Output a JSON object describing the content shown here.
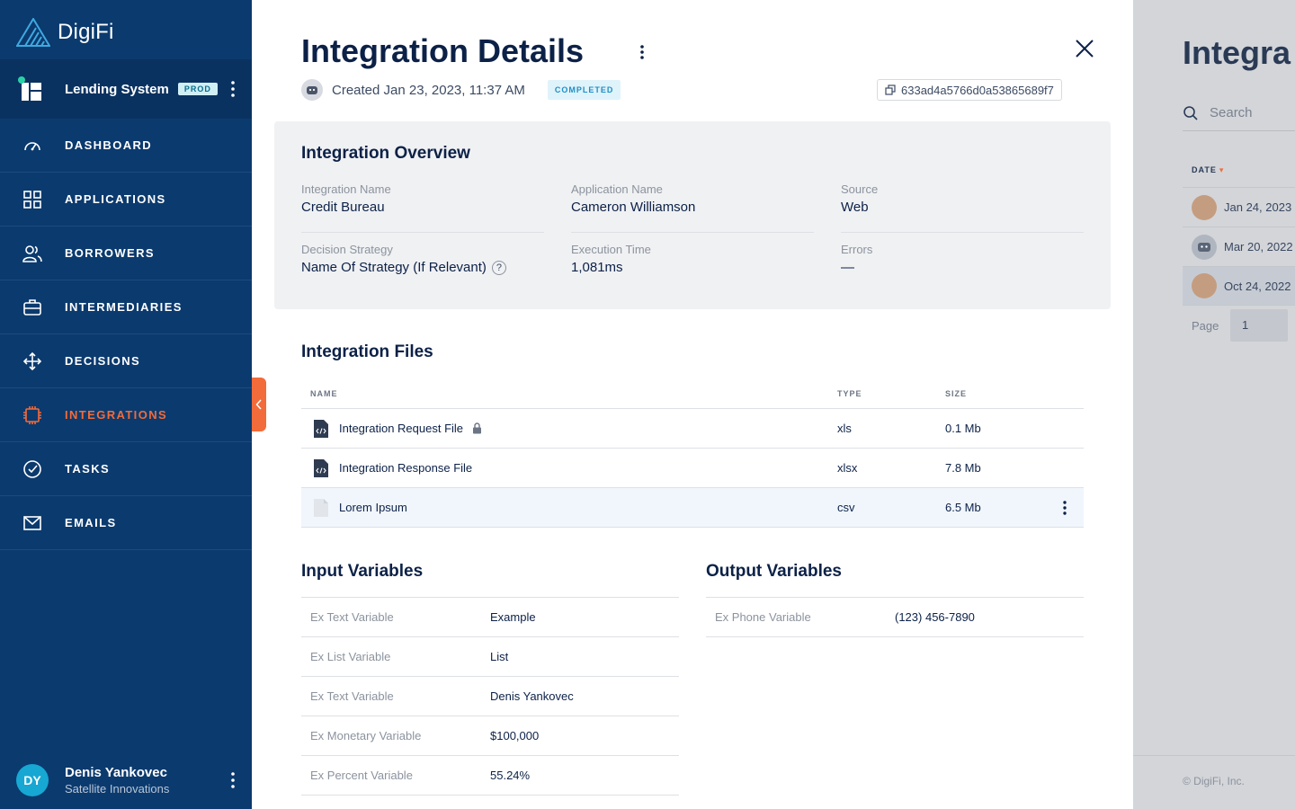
{
  "app": {
    "brand": "DigiFi"
  },
  "system": {
    "name": "Lending System",
    "env_badge": "PROD"
  },
  "nav": [
    {
      "label": "DASHBOARD",
      "icon": "dashboard-icon"
    },
    {
      "label": "APPLICATIONS",
      "icon": "applications-icon"
    },
    {
      "label": "BORROWERS",
      "icon": "borrowers-icon"
    },
    {
      "label": "INTERMEDIARIES",
      "icon": "intermediaries-icon"
    },
    {
      "label": "DECISIONS",
      "icon": "decisions-icon"
    },
    {
      "label": "INTEGRATIONS",
      "icon": "integrations-icon",
      "active": true
    },
    {
      "label": "TASKS",
      "icon": "tasks-icon"
    },
    {
      "label": "EMAILS",
      "icon": "emails-icon"
    }
  ],
  "user": {
    "initials": "DY",
    "name": "Denis Yankovec",
    "org": "Satellite Innovations"
  },
  "colors": {
    "sidebar": "#0b3a6e",
    "accent": "#f26b3a",
    "badge_blue": "#1e8fc6",
    "avatar": "#17a7d3"
  },
  "details": {
    "title": "Integration Details",
    "created": "Created Jan 23, 2023, 11:37 AM",
    "status": "COMPLETED",
    "id": "633ad4a5766d0a53865689f7"
  },
  "overview": {
    "heading": "Integration Overview",
    "fields": [
      {
        "label": "Integration Name",
        "value": "Credit Bureau"
      },
      {
        "label": "Application Name",
        "value": "Cameron Williamson"
      },
      {
        "label": "Source",
        "value": "Web"
      },
      {
        "label": "Decision Strategy",
        "value": "Name Of Strategy (If Relevant)"
      },
      {
        "label": "Execution Time",
        "value": "1,081ms"
      },
      {
        "label": "Errors",
        "value": "—"
      }
    ],
    "help_glyph": "?"
  },
  "files": {
    "heading": "Integration Files",
    "columns": {
      "name": "NAME",
      "type": "TYPE",
      "size": "SIZE"
    },
    "rows": [
      {
        "name": "Integration Request File",
        "type": "xls",
        "size": "0.1 Mb",
        "icon": "code-file-icon",
        "locked": true
      },
      {
        "name": "Integration Response File",
        "type": "xlsx",
        "size": "7.8 Mb",
        "icon": "code-file-icon"
      },
      {
        "name": "Lorem Ipsum",
        "type": "csv",
        "size": "6.5 Mb",
        "icon": "blank-file-icon",
        "hovered": true
      }
    ]
  },
  "input_vars": {
    "heading": "Input Variables",
    "rows": [
      {
        "key": "Ex Text Variable",
        "value": "Example"
      },
      {
        "key": "Ex List Variable",
        "value": "List"
      },
      {
        "key": "Ex Text Variable",
        "value": "Denis Yankovec"
      },
      {
        "key": "Ex Monetary Variable",
        "value": "$100,000"
      },
      {
        "key": "Ex Percent Variable",
        "value": "55.24%"
      }
    ]
  },
  "output_vars": {
    "heading": "Output Variables",
    "rows": [
      {
        "key": "Ex Phone Variable",
        "value": "(123) 456-7890"
      }
    ]
  },
  "background": {
    "title": "Integra",
    "search_placeholder": "Search",
    "date_header": "DATE",
    "dates": [
      "Jan 24, 2023",
      "Mar 20, 2022",
      "Oct 24, 2022"
    ],
    "page_label": "Page",
    "page_value": "1",
    "footer": "© DigiFi, Inc."
  }
}
